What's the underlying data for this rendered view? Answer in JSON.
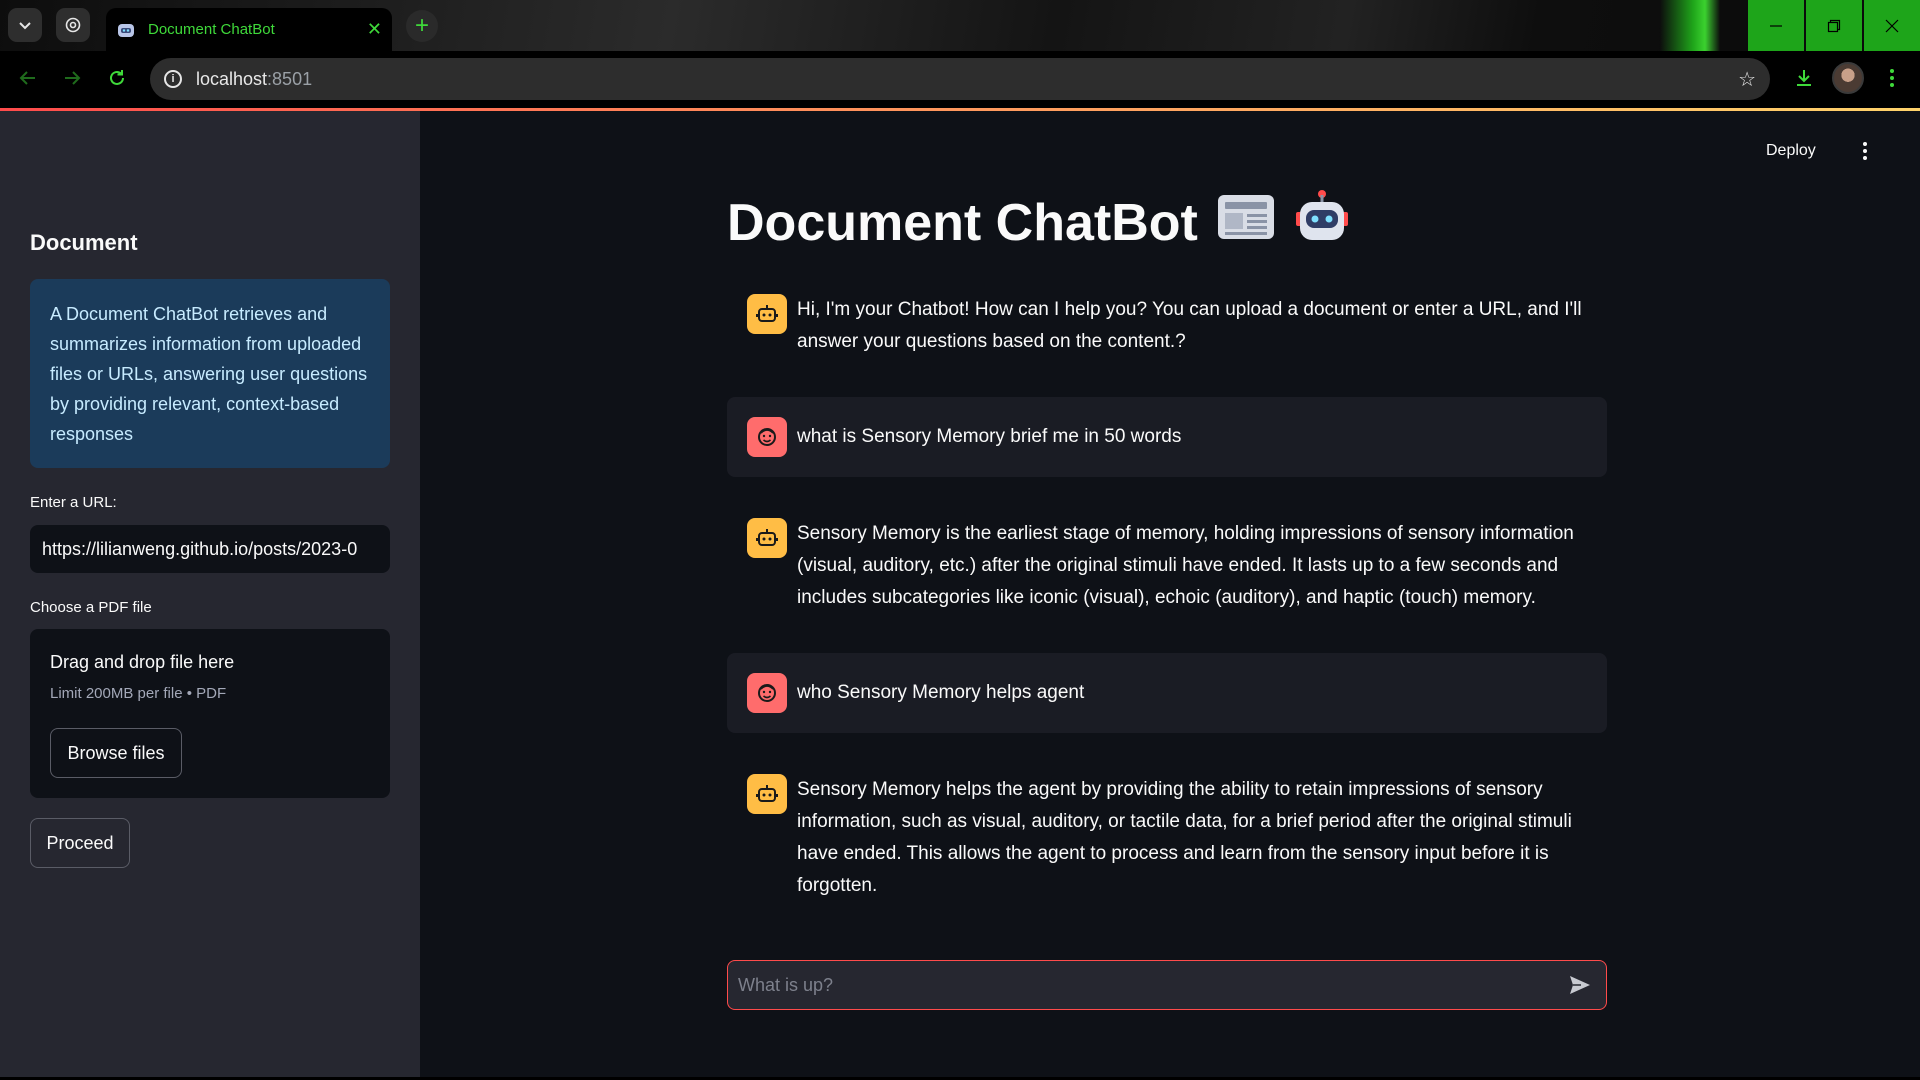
{
  "browser": {
    "tab_title": "Document ChatBot",
    "url_host": "localhost",
    "url_port": ":8501"
  },
  "colors": {
    "accent_green": "#3fd93a",
    "streamlit_red": "#ff4b4b",
    "info_bg": "#1b3b5a",
    "bot_avatar": "#ffbd45",
    "user_avatar": "#ff6c6c"
  },
  "sidebar": {
    "title": "Document",
    "info": "A Document ChatBot retrieves and summarizes information from uploaded files or URLs, answering user questions by providing relevant, context-based responses",
    "url_label": "Enter a URL:",
    "url_value": "https://lilianweng.github.io/posts/2023-0",
    "pdf_label": "Choose a PDF file",
    "drop_title": "Drag and drop file here",
    "drop_limit": "Limit 200MB per file • PDF",
    "browse_label": "Browse files",
    "proceed_label": "Proceed"
  },
  "header": {
    "deploy_label": "Deploy"
  },
  "main": {
    "title": "Document ChatBot",
    "title_icons": [
      "newspaper-icon",
      "robot-icon"
    ],
    "messages": [
      {
        "role": "assistant",
        "text": "Hi, I'm your Chatbot! How can I help you? You can upload a document or enter a URL, and I'll answer your questions based on the content.?"
      },
      {
        "role": "user",
        "text": "what is Sensory Memory brief me in 50 words"
      },
      {
        "role": "assistant",
        "text": "Sensory Memory is the earliest stage of memory, holding impressions of sensory information (visual, auditory, etc.) after the original stimuli have ended. It lasts up to a few seconds and includes subcategories like iconic (visual), echoic (auditory), and haptic (touch) memory."
      },
      {
        "role": "user",
        "text": "who Sensory Memory helps agent"
      },
      {
        "role": "assistant",
        "text": "Sensory Memory helps the agent by providing the ability to retain impressions of sensory information, such as visual, auditory, or tactile data, for a brief period after the original stimuli have ended. This allows the agent to process and learn from the sensory input before it is forgotten."
      }
    ],
    "input_placeholder": "What is up?"
  }
}
